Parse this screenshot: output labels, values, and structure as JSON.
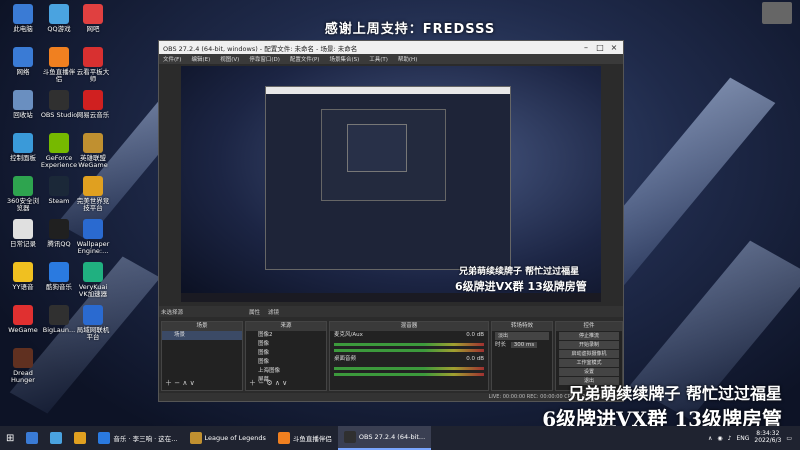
{
  "banner": "感谢上周支持：FREDSSS",
  "desktop_icons": [
    {
      "label": "此电脑",
      "color": "#3a7bd5"
    },
    {
      "label": "QQ游戏",
      "color": "#4aa3e0"
    },
    {
      "label": "网吧",
      "color": "#e04040"
    },
    {
      "label": "网络",
      "color": "#3a7bd5"
    },
    {
      "label": "斗鱼直播伴侣",
      "color": "#f08020"
    },
    {
      "label": "云看平板大师",
      "color": "#d83030"
    },
    {
      "label": "回收站",
      "color": "#6a8fc0"
    },
    {
      "label": "OBS Studio",
      "color": "#303030"
    },
    {
      "label": "网易云音乐",
      "color": "#d02020"
    },
    {
      "label": "控制面板",
      "color": "#3a9ad9"
    },
    {
      "label": "GeForce Experience",
      "color": "#76b900"
    },
    {
      "label": "英雄联盟 WeGame",
      "color": "#c09030"
    },
    {
      "label": "360安全浏览器",
      "color": "#2ea44f"
    },
    {
      "label": "Steam",
      "color": "#1b2838"
    },
    {
      "label": "完美世界竞技平台",
      "color": "#e0a020"
    },
    {
      "label": "日常记录",
      "color": "#e0e0e0"
    },
    {
      "label": "腾讯QQ",
      "color": "#202020"
    },
    {
      "label": "Wallpaper Engine:...",
      "color": "#2a6ad0"
    },
    {
      "label": "YY语音",
      "color": "#f0c020"
    },
    {
      "label": "酷狗音乐",
      "color": "#2a7ae0"
    },
    {
      "label": "VeryKuai VK加速器",
      "color": "#20b080"
    },
    {
      "label": "WeGame",
      "color": "#e03030"
    },
    {
      "label": "BigLaun...",
      "color": "#303030"
    },
    {
      "label": "局域网联机平台",
      "color": "#2a6ad0"
    },
    {
      "label": "Dread Hunger",
      "color": "#603020"
    }
  ],
  "obs": {
    "title": "OBS 27.2.4 (64-bit, windows) - 配置文件: 未命名 - 场景: 未命名",
    "menu": [
      "文件(F)",
      "编辑(E)",
      "视图(V)",
      "停靠窗口(D)",
      "配置文件(P)",
      "场景集合(S)",
      "工具(T)",
      "帮助(H)"
    ],
    "no_source": "未选择源",
    "dock_tabs": [
      "属性",
      "滤镜"
    ],
    "docks": {
      "scenes": {
        "title": "场景",
        "items": [
          "场景"
        ]
      },
      "sources": {
        "title": "来源",
        "items": [
          "图像2",
          "图像",
          "图像",
          "图像",
          "上海图像",
          "屏幕"
        ]
      },
      "mixer": {
        "title": "混音器",
        "channels": [
          {
            "name": "桌面音频",
            "db": "0.0 dB"
          },
          {
            "name": "麦克风/Aux",
            "db": "0.0 dB"
          }
        ]
      },
      "transitions": {
        "title": "转场特效",
        "type": "淡出",
        "duration_label": "时长",
        "duration": "300 ms"
      },
      "controls": {
        "title": "控件",
        "buttons": [
          "停止推流",
          "开始录制",
          "启动虚拟摄像机",
          "工作室模式",
          "设置",
          "退出"
        ]
      }
    },
    "status": "LIVE: 00:00:00   REC: 00:00:00   CPU: 1.1%, 30.00 fps"
  },
  "preview_captions": {
    "line1": "兄弟萌续续牌子 帮忙过过福星",
    "line2": "6级牌进VX群 13级牌房管"
  },
  "overlay_captions": {
    "line1": "兄弟萌续续牌子 帮忙过过福星",
    "line2": "6级牌进VX群 13级牌房管"
  },
  "taskbar": {
    "items": [
      {
        "label": "",
        "color": "#3a7bd5",
        "active": false
      },
      {
        "label": "",
        "color": "#4aa3e0",
        "active": false
      },
      {
        "label": "",
        "color": "#e0a020",
        "active": false
      },
      {
        "label": "音乐 · 李三响 · 这在...",
        "color": "#2a7ae0",
        "active": false
      },
      {
        "label": "League of Legends",
        "color": "#c09030",
        "active": false
      },
      {
        "label": "斗鱼直播伴侣",
        "color": "#f08020",
        "active": false
      },
      {
        "label": "OBS 27.2.4 (64-bit...",
        "color": "#303030",
        "active": true
      }
    ],
    "lang": "ENG",
    "time": "8:34:32",
    "date": "2022/6/3"
  }
}
